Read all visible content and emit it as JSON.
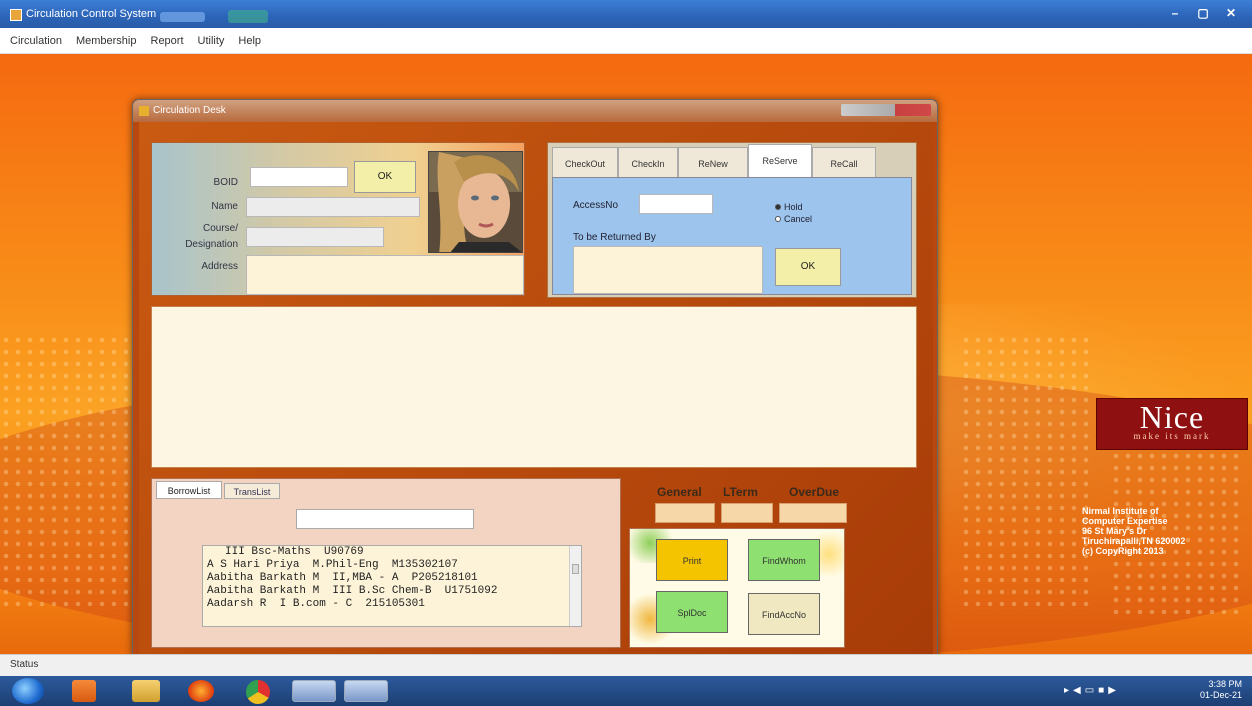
{
  "app": {
    "title": "Circulation Control System",
    "window_buttons": [
      "–",
      "▢",
      "✕"
    ]
  },
  "menu": [
    "Circulation",
    "Membership",
    "Report",
    "Utility",
    "Help"
  ],
  "child_window": {
    "title": "Circulation Desk"
  },
  "student": {
    "boid_label": "BOID",
    "boid_value": "",
    "ok_label": "OK",
    "name_label": "Name",
    "course_label": "Course/",
    "designation_label": "Designation",
    "address_label": "Address"
  },
  "tabs": {
    "items": [
      "CheckOut",
      "CheckIn",
      "ReNew",
      "ReServe",
      "ReCall"
    ],
    "active": "ReServe",
    "accessno_label": "AccessNo",
    "returned_by_label": "To be Returned By",
    "radio_hold": "Hold",
    "radio_cancel": "Cancel",
    "ok_label": "OK"
  },
  "borrow": {
    "tab_borrow": "BorrowList",
    "tab_trans": "TransList",
    "rows": [
      "III Bsc-Maths  U90769",
      "A S Hari Priya  M.Phil-Eng  M135302107",
      "Aabitha Barkath M  II,MBA - A  P205218101",
      "Aabitha Barkath M  III B.Sc Chem-B  U1751092",
      "Aadarsh R  I B.com - C  215105301"
    ]
  },
  "counters": {
    "general": "General",
    "lterm": "LTerm",
    "overdue": "OverDue"
  },
  "actions": {
    "print": "Print",
    "findwhom": "FindWhom",
    "spldoc": "SplDoc",
    "findaccno": "FindAccNo"
  },
  "branding": {
    "logo_big": "Nice",
    "logo_small": "make its mark",
    "info_lines": [
      "Nirmal Institute of",
      "Computer Expertise",
      "96 St Mary's Dr",
      "Tiruchirapalli,TN 620002",
      "(c) CopyRight 2013"
    ]
  },
  "status": {
    "text": "Status"
  },
  "taskbar": {
    "time": "3:38 PM",
    "date": "01-Dec-21"
  },
  "colors": {
    "accent_orange": "#f88a18",
    "tab_blue": "#9cc4ec",
    "button_yellow": "#f5c400",
    "button_green": "#8ee070"
  }
}
